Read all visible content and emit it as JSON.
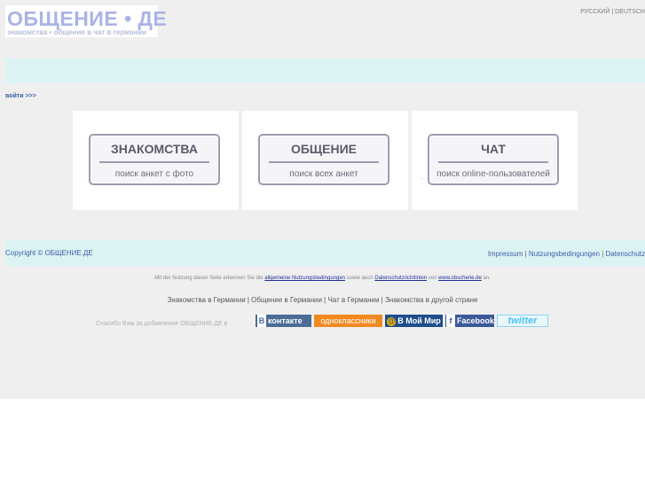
{
  "header": {
    "logo_title": "ОБЩЕНИЕ • ДЕ",
    "logo_subtitle": "знакомства • общение в чат в германии",
    "lang_ru": "РУССКИЙ",
    "lang_sep": "|",
    "lang_de": "DEUTSCH"
  },
  "login_link": "войти >>>",
  "panels": [
    {
      "title": "ЗНАКОМСТВА",
      "subtitle": "поиск анкет с фото"
    },
    {
      "title": "ОБЩЕНИЕ",
      "subtitle": "поиск всех анкет"
    },
    {
      "title": "ЧАТ",
      "subtitle": "поиск online-пользователей"
    }
  ],
  "dot_mark": ".",
  "footer": {
    "copyright": "Copyright © ОБЩЕНИЕ.ДЕ",
    "links": [
      "Impressum",
      "Nutzungsbedingungen",
      "Datenschutz"
    ],
    "sep": " | "
  },
  "terms": {
    "prefix": "Mit der Nutzung dieser Seite erkennen Sie die ",
    "link1": "allgemeine Nutzungsbedingungen",
    "mid1": " sowie auch ",
    "link2": "Datenschutzrichtlinien",
    "mid2": " von ",
    "link3": "www.obscherie.de",
    "suffix": " an."
  },
  "seo_links": "Знакомства в Германии | Общение в Германии | Чат в Германии | Знакомства в другой стране",
  "thanks": "Спасибо Вам за добавление ОБЩЕНИЕ.ДЕ в",
  "social": {
    "vk": "контакте",
    "vk_badge": "В",
    "ok": "одноклассники",
    "mm": "В Мой Мир",
    "mm_badge": "@",
    "fb": "Facebook",
    "fb_badge": "f",
    "tw": "twitter"
  },
  "colors": {
    "accent": "#3b5ea8",
    "band": "#dcf3f3",
    "logo": "#a9b3e6"
  }
}
